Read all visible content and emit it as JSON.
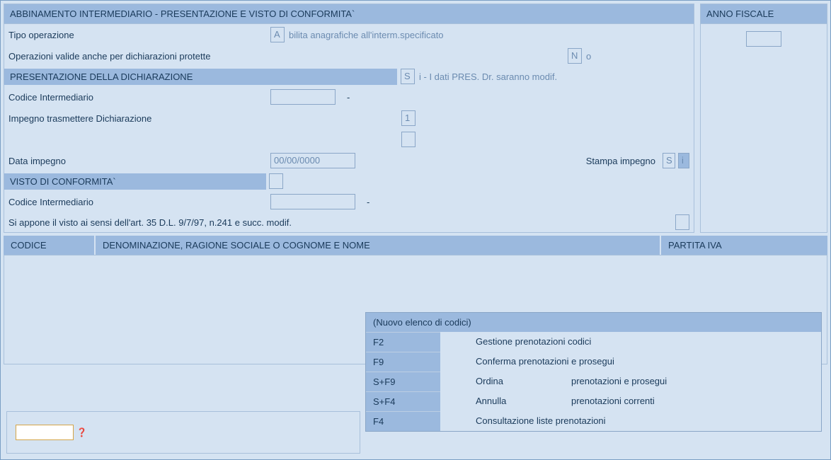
{
  "main": {
    "title": "ABBINAMENTO INTERMEDIARIO - PRESENTAZIONE E VISTO DI CONFORMITA`",
    "tipo_op_label": "Tipo operazione",
    "tipo_op_prefill": "A",
    "tipo_op_hint": "bilita anagrafiche all'interm.specificato",
    "op_valide_label": "Operazioni valide anche per dichiarazioni protette",
    "op_valide_prefill": "N",
    "op_valide_hint": "o",
    "presentazione_section": "PRESENTAZIONE DELLA DICHIARAZIONE",
    "presentazione_prefill": "S",
    "presentazione_hint": "i - I dati PRES. Dr. saranno modif.",
    "cod_interm_label": "Codice Intermediario",
    "cod_interm_value": "",
    "cod_interm_dash": "-",
    "impegno_label": "Impegno trasmettere Dichiarazione",
    "impegno_value": "1",
    "data_impegno_label": "Data impegno",
    "data_impegno_value": "00/00/0000",
    "stampa_label": "Stampa impegno",
    "stampa_val1": "S",
    "stampa_val2": "i",
    "visto_section": "VISTO DI CONFORMITA`",
    "cod_interm2_label": "Codice Intermediario",
    "cod_interm2_dash": "-",
    "visto_note": "Si appone il visto ai sensi dell'art. 35 D.L. 9/7/97, n.241 e succ. modif."
  },
  "anno": {
    "title": "ANNO FISCALE"
  },
  "table": {
    "col_codice": "CODICE",
    "col_denom": "DENOMINAZIONE, RAGIONE SOCIALE O COGNOME E NOME",
    "col_partita": "PARTITA IVA"
  },
  "popup": {
    "title": "(Nuovo elenco di codici)",
    "rows": [
      {
        "key": "F2",
        "desc": "Gestione prenotazioni codici"
      },
      {
        "key": "F9",
        "desc": "Conferma prenotazioni e prosegui"
      },
      {
        "key": "S+F9",
        "desc1": "Ordina",
        "desc2": "prenotazioni e prosegui"
      },
      {
        "key": "S+F4",
        "desc1": "Annulla",
        "desc2": "prenotazioni correnti"
      },
      {
        "key": "F4",
        "desc": "Consultazione liste prenotazioni"
      }
    ]
  }
}
